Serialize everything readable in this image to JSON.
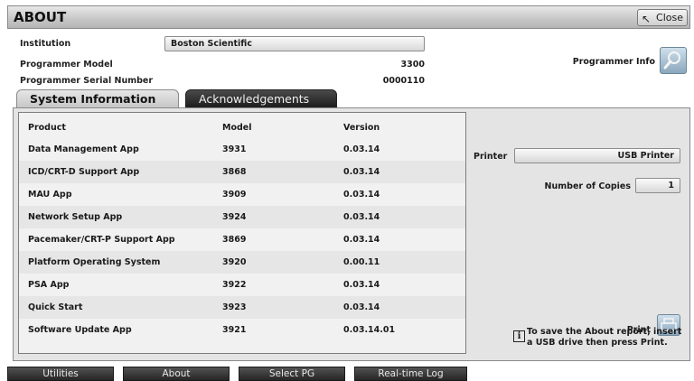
{
  "window": {
    "title": "ABOUT",
    "close_label": "Close"
  },
  "info": {
    "institution_label": "Institution",
    "institution_value": "Boston Scientific",
    "model_label": "Programmer Model",
    "model_value": "3300",
    "serial_label": "Programmer Serial Number",
    "serial_value": "0000110",
    "programmer_info_label": "Programmer Info"
  },
  "tabs": [
    {
      "label": "System Information",
      "active": true
    },
    {
      "label": "Acknowledgements",
      "active": false
    }
  ],
  "table": {
    "headers": [
      "Product",
      "Model",
      "Version"
    ],
    "rows": [
      [
        "Data Management App",
        "3931",
        "0.03.14"
      ],
      [
        "ICD/CRT-D Support App",
        "3868",
        "0.03.14"
      ],
      [
        "MAU App",
        "3909",
        "0.03.14"
      ],
      [
        "Network Setup App",
        "3924",
        "0.03.14"
      ],
      [
        "Pacemaker/CRT-P Support App",
        "3869",
        "0.03.14"
      ],
      [
        "Platform Operating System",
        "3920",
        "0.00.11"
      ],
      [
        "PSA App",
        "3922",
        "0.03.14"
      ],
      [
        "Quick Start",
        "3923",
        "0.03.14"
      ],
      [
        "Software Update App",
        "3921",
        "0.03.14.01"
      ]
    ]
  },
  "print": {
    "printer_label": "Printer",
    "printer_value": "USB Printer",
    "copies_label": "Number of Copies",
    "copies_value": "1",
    "print_label": "Print",
    "info_text": "To save the About report, insert a USB drive then press Print."
  },
  "nav": [
    "Utilities",
    "About",
    "Select PG",
    "Real-time Log"
  ],
  "icons": {
    "close": "arrow-cursor-icon",
    "programmer_info": "magnifier-icon",
    "print": "printer-icon",
    "info": "info-icon"
  }
}
